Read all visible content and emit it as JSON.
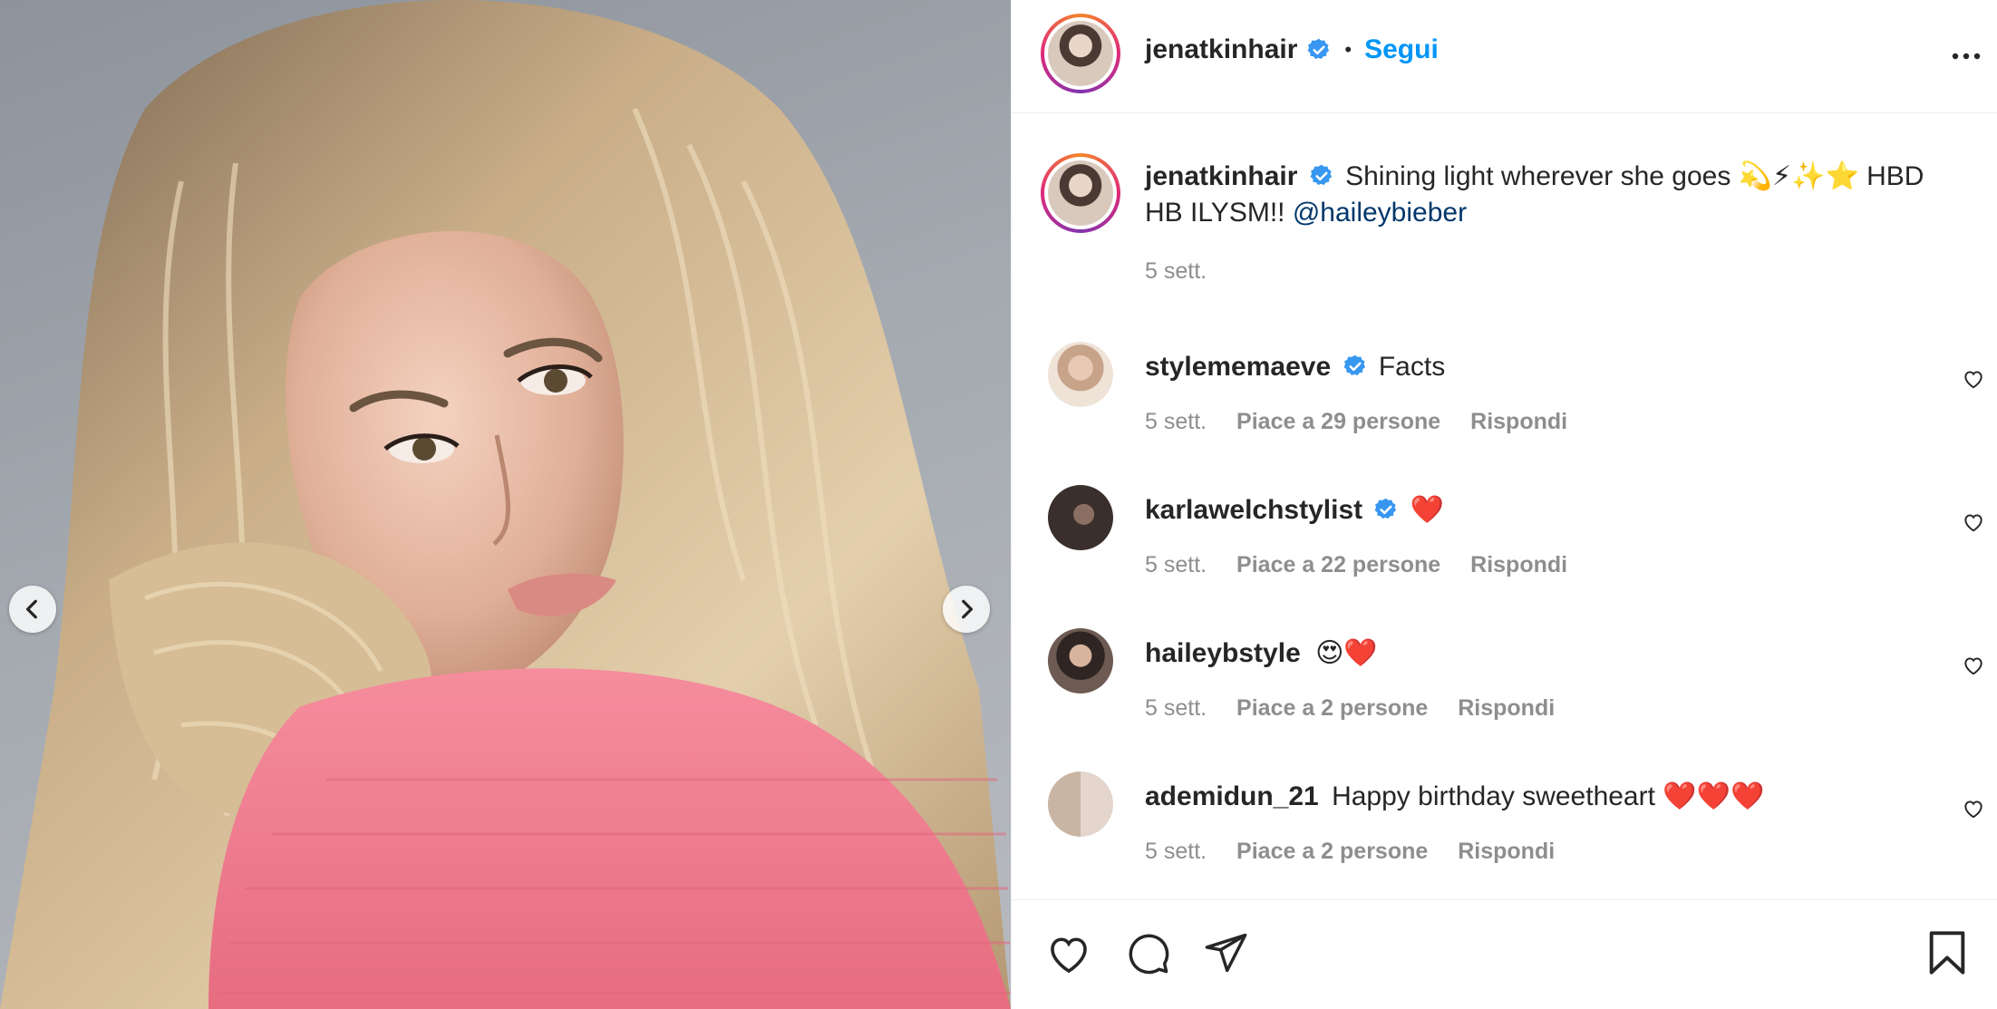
{
  "post": {
    "author": "jenatkinhair",
    "follow_label": "Segui",
    "dot": "•",
    "caption": {
      "author": "jenatkinhair",
      "text": "Shining light wherever she goes 💫⚡✨⭐ HBD HB ILYSM!! ",
      "mention": "@haileybieber",
      "time": "5 sett."
    },
    "comments": [
      {
        "user": "stylememaeve",
        "verified": true,
        "text": "Facts",
        "time": "5 sett.",
        "likes": "Piace a 29 persone",
        "reply": "Rispondi"
      },
      {
        "user": "karlawelchstylist",
        "verified": true,
        "text": "❤️",
        "time": "5 sett.",
        "likes": "Piace a 22 persone",
        "reply": "Rispondi"
      },
      {
        "user": "haileybstyle",
        "verified": false,
        "text": "😍❤️",
        "time": "5 sett.",
        "likes": "Piace a 2 persone",
        "reply": "Rispondi"
      },
      {
        "user": "ademidun_21",
        "verified": false,
        "text": "Happy birthday sweetheart ❤️❤️❤️",
        "time": "5 sett.",
        "likes": "Piace a 2 persone",
        "reply": "Rispondi"
      }
    ]
  },
  "icons": {
    "verified": "verified-badge-icon",
    "more": "more-options-icon",
    "like": "heart-icon",
    "comment": "comment-icon",
    "share": "paper-plane-icon",
    "save": "bookmark-icon",
    "prev": "chevron-left-icon",
    "next": "chevron-right-icon"
  },
  "colors": {
    "link": "#0095f6",
    "mention": "#00376b",
    "verified": "#3897f0",
    "secondary_text": "#8e8e8e",
    "sweater": "#f0788c"
  }
}
